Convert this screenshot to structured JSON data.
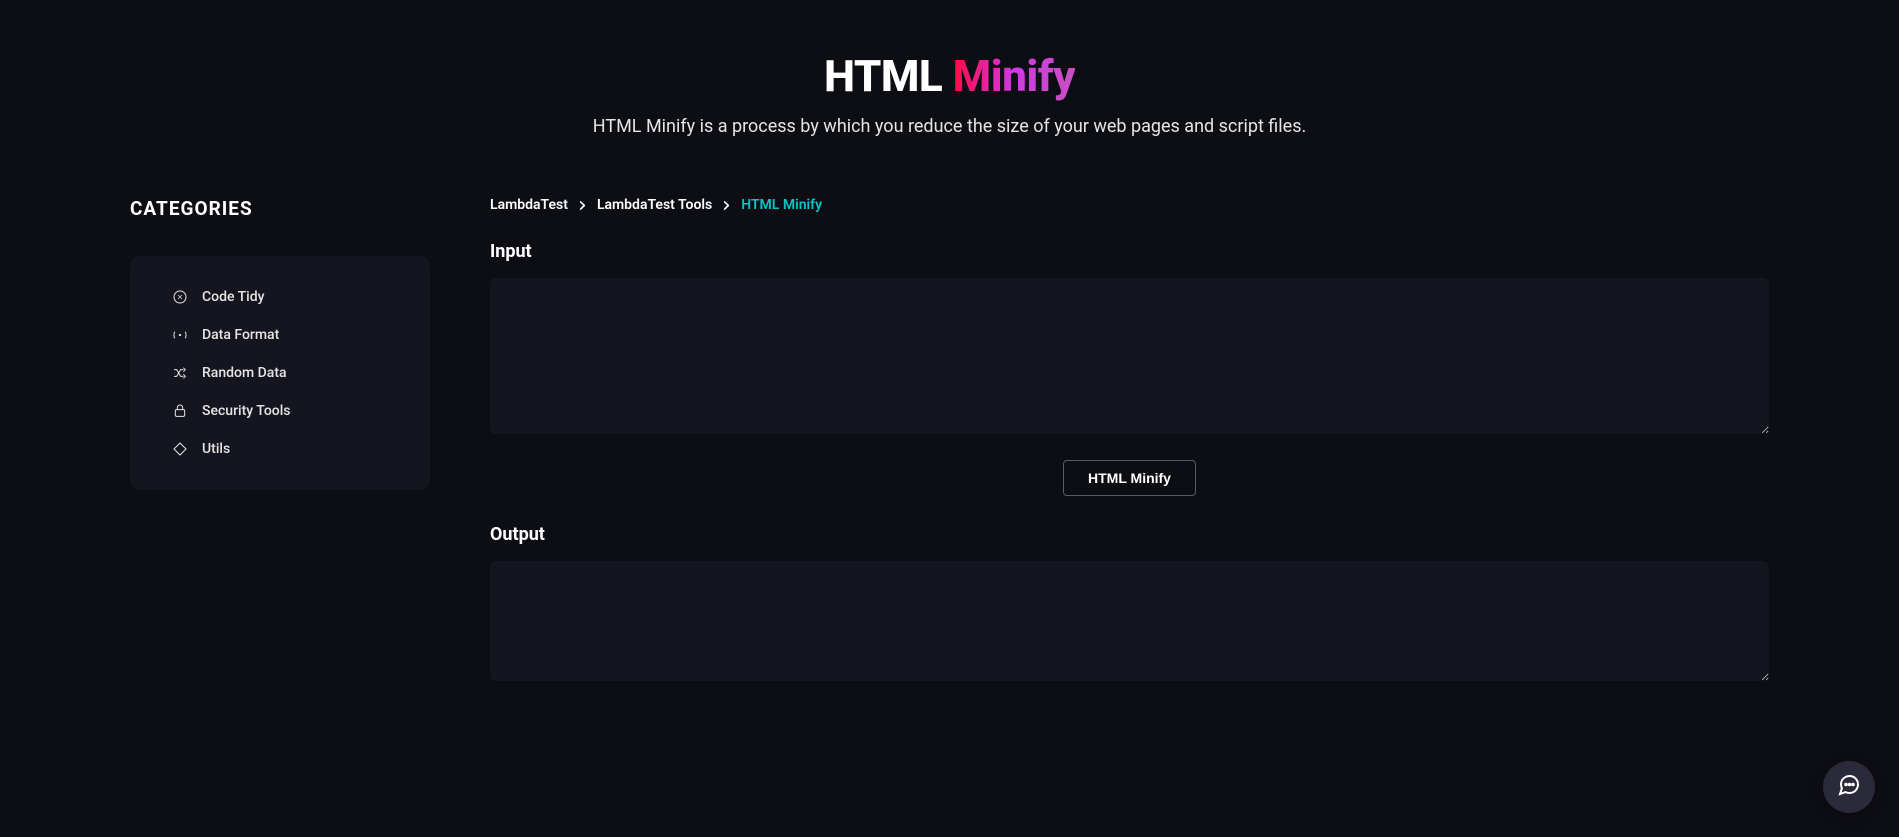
{
  "hero": {
    "title_white": "HTML ",
    "title_gradient": "Minify",
    "subtitle": "HTML Minify is a process by which you reduce the size of your web pages and script files."
  },
  "sidebar": {
    "heading": "CATEGORIES",
    "items": [
      {
        "label": "Code Tidy",
        "icon": "code-tidy"
      },
      {
        "label": "Data Format",
        "icon": "data-format"
      },
      {
        "label": "Random Data",
        "icon": "random-data"
      },
      {
        "label": "Security Tools",
        "icon": "security"
      },
      {
        "label": "Utils",
        "icon": "utils"
      }
    ]
  },
  "breadcrumb": {
    "items": [
      {
        "label": "LambdaTest",
        "link": true
      },
      {
        "label": "LambdaTest Tools",
        "link": true
      },
      {
        "label": "HTML Minify",
        "link": false
      }
    ]
  },
  "main": {
    "input_label": "Input",
    "input_value": "",
    "button_label": "HTML Minify",
    "output_label": "Output",
    "output_value": ""
  },
  "colors": {
    "accent": "#00c8c8",
    "panel": "#15151f",
    "bg": "#0d0d14"
  }
}
